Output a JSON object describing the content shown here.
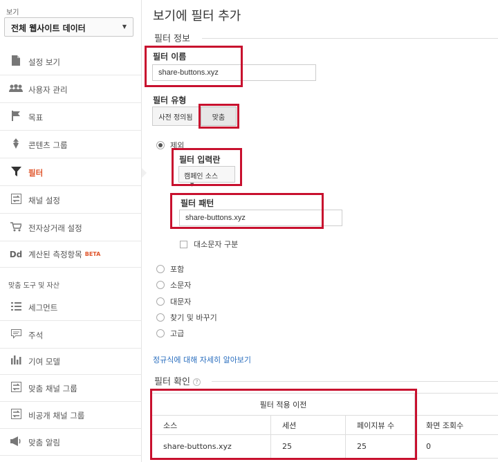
{
  "sidebar": {
    "view_label": "보기",
    "view_select": "전체 웹사이트 데이터",
    "items": [
      {
        "label": "설정 보기",
        "icon": "document-icon"
      },
      {
        "label": "사용자 관리",
        "icon": "users-icon"
      },
      {
        "label": "목표",
        "icon": "flag-icon"
      },
      {
        "label": "콘텐츠 그룹",
        "icon": "content-group-icon"
      },
      {
        "label": "필터",
        "icon": "filter-icon",
        "active": true
      },
      {
        "label": "채널 설정",
        "icon": "channel-settings-icon"
      },
      {
        "label": "전자상거래 설정",
        "icon": "cart-icon"
      },
      {
        "label": "계산된 측정항목",
        "icon": "calculated-metric-icon",
        "badge": "BETA"
      }
    ],
    "section_label": "맞춤 도구 및 자산",
    "tools": [
      {
        "label": "세그먼트",
        "icon": "segment-icon"
      },
      {
        "label": "주석",
        "icon": "annotation-icon"
      },
      {
        "label": "기여 모델",
        "icon": "attribution-icon"
      },
      {
        "label": "맞춤 채널 그룹",
        "icon": "channel-group-icon"
      },
      {
        "label": "비공개 채널 그룹",
        "icon": "private-channel-group-icon"
      },
      {
        "label": "맞춤 알림",
        "icon": "alert-icon"
      }
    ],
    "icon_glyphs": {
      "dd": "Dd"
    }
  },
  "main": {
    "title": "보기에 필터 추가",
    "filter_info_title": "필터 정보",
    "filter_name_label": "필터 이름",
    "filter_name_value": "share-buttons.xyz",
    "filter_type_label": "필터 유형",
    "btn_predefined": "사전 정의됨",
    "btn_custom": "맞춤",
    "radio_exclude": "제외",
    "filter_field_label": "필터 입력란",
    "filter_field_value": "캠페인 소스",
    "filter_pattern_label": "필터 패턴",
    "filter_pattern_value": "share-buttons.xyz",
    "case_sensitive": "대소문자 구분",
    "radio_include": "포함",
    "radio_lowercase": "소문자",
    "radio_uppercase": "대문자",
    "radio_search_replace": "찾기 및 바꾸기",
    "radio_advanced": "고급",
    "regex_link": "정규식에 대해 자세히 알아보기",
    "verify_title": "필터 확인",
    "table": {
      "group_header": "필터 적용 이전",
      "columns": [
        "소스",
        "세션",
        "페이지뷰 수",
        "화면 조회수"
      ],
      "row": [
        "share-buttons.xyz",
        "25",
        "25",
        "0"
      ]
    }
  },
  "colors": {
    "accent": "#e0552b",
    "highlight_box": "#c8102e",
    "link": "#2b6fbf"
  }
}
